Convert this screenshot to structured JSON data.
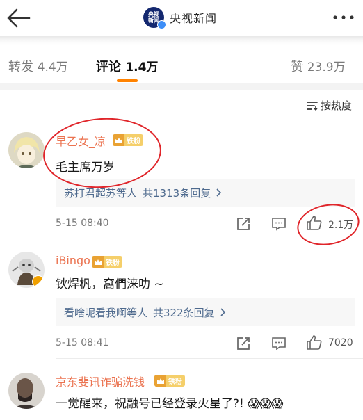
{
  "header": {
    "account_logo_text": [
      "央视",
      "新闻"
    ],
    "account_name": "央视新闻"
  },
  "tabs": [
    {
      "label": "转发",
      "count": "4.4万"
    },
    {
      "label": "评论",
      "count": "1.4万",
      "active": true
    },
    {
      "label": "赞",
      "count": "23.9万"
    }
  ],
  "sort": {
    "label": "按热度"
  },
  "comments": [
    {
      "username": "早乙女_凉",
      "badge": "铁粉",
      "content": "毛主席万岁",
      "reply_names": "苏打君超苏等人",
      "reply_count": "共1313条回复",
      "timestamp": "5-15 08:40",
      "likes": "2.1万"
    },
    {
      "username": "iBingo",
      "badge": "铁粉",
      "content": "钬焊杋，窩們涞叻 ~",
      "reply_names": "看啥呢看我啊等人",
      "reply_count": "共322条回复",
      "timestamp": "5-15 08:41",
      "likes": "7020"
    },
    {
      "username": "京东斐讯诈骗洗钱",
      "badge": "铁粉",
      "content": "一觉醒来，祝融号已经登录火星了?!"
    }
  ],
  "colors": {
    "accent": "#ff8200",
    "username": "#eb7350",
    "reply_link": "#4e6a8e",
    "annotation": "#e0252a"
  }
}
